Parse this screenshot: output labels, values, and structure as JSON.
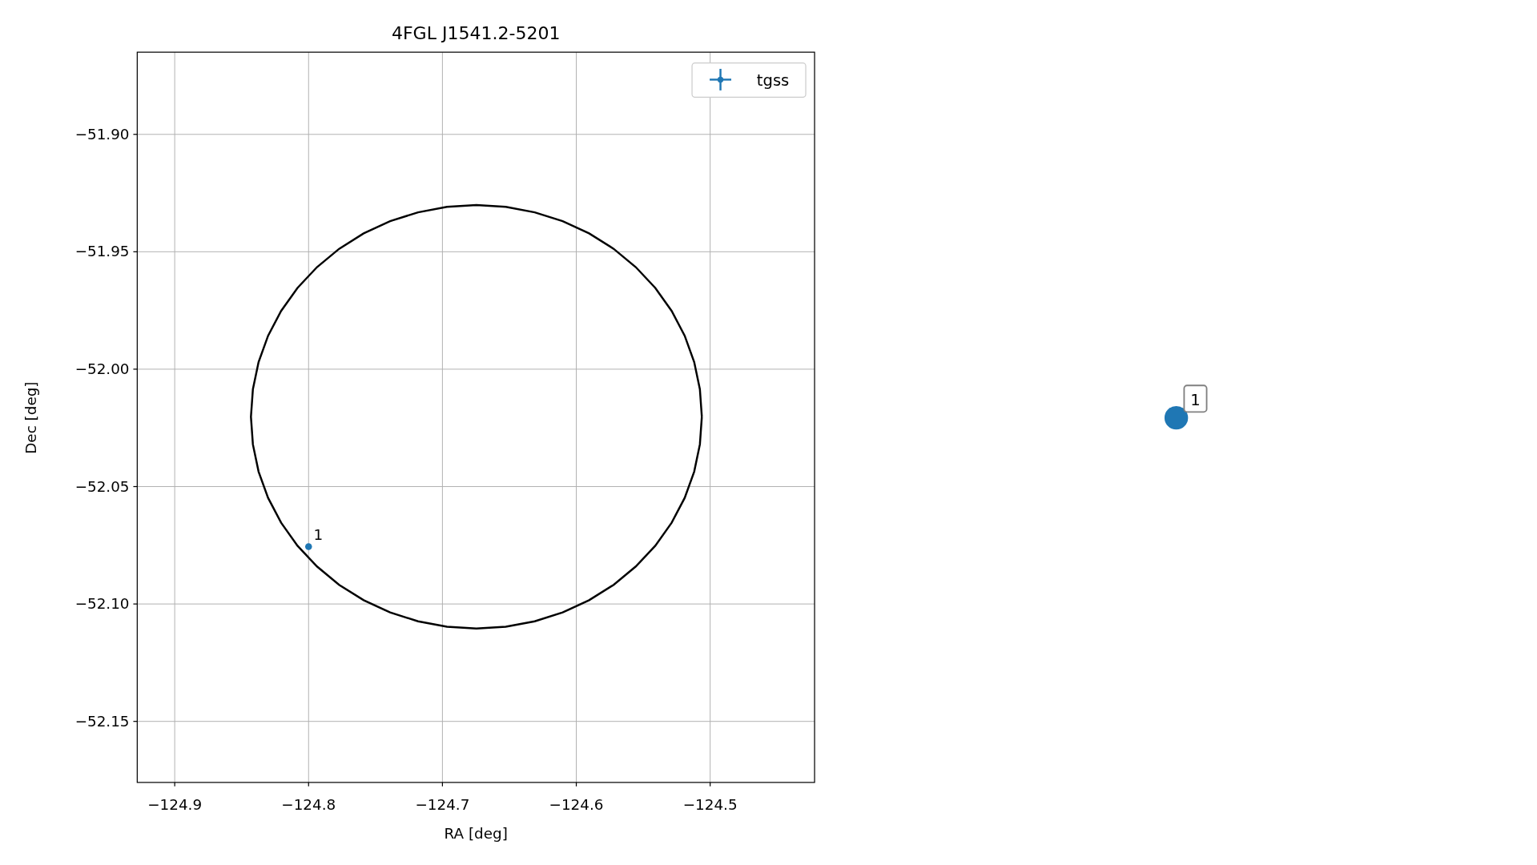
{
  "figure": {
    "chart_data": {
      "type": "scatter",
      "title": "4FGL J1541.2-5201",
      "xlabel": "RA [deg]",
      "ylabel": "Dec [deg]",
      "x": [
        -124.8
      ],
      "series": [
        {
          "name": "tgss",
          "color": "#1f77b4",
          "values": [
            -52.0756
          ]
        }
      ],
      "xlim": [
        -124.928,
        -124.422
      ],
      "ylim": [
        -52.176,
        -51.865
      ],
      "xticks": [
        {
          "value": -124.9,
          "label": "−124.9"
        },
        {
          "value": -124.8,
          "label": "−124.8"
        },
        {
          "value": -124.7,
          "label": "−124.7"
        },
        {
          "value": -124.6,
          "label": "−124.6"
        },
        {
          "value": -124.5,
          "label": "−124.5"
        }
      ],
      "yticks": [
        {
          "value": -51.9,
          "label": "−51.90"
        },
        {
          "value": -51.95,
          "label": "−51.95"
        },
        {
          "value": -52.0,
          "label": "−52.00"
        },
        {
          "value": -52.05,
          "label": "−52.05"
        },
        {
          "value": -52.1,
          "label": "−52.10"
        },
        {
          "value": -52.15,
          "label": "−52.15"
        }
      ],
      "grid": true,
      "annotations": [
        {
          "text": "1",
          "x": -124.8,
          "y": -52.0756
        }
      ]
    }
  },
  "marker_panel": {
    "color": "#1f77b4",
    "label": "1"
  }
}
